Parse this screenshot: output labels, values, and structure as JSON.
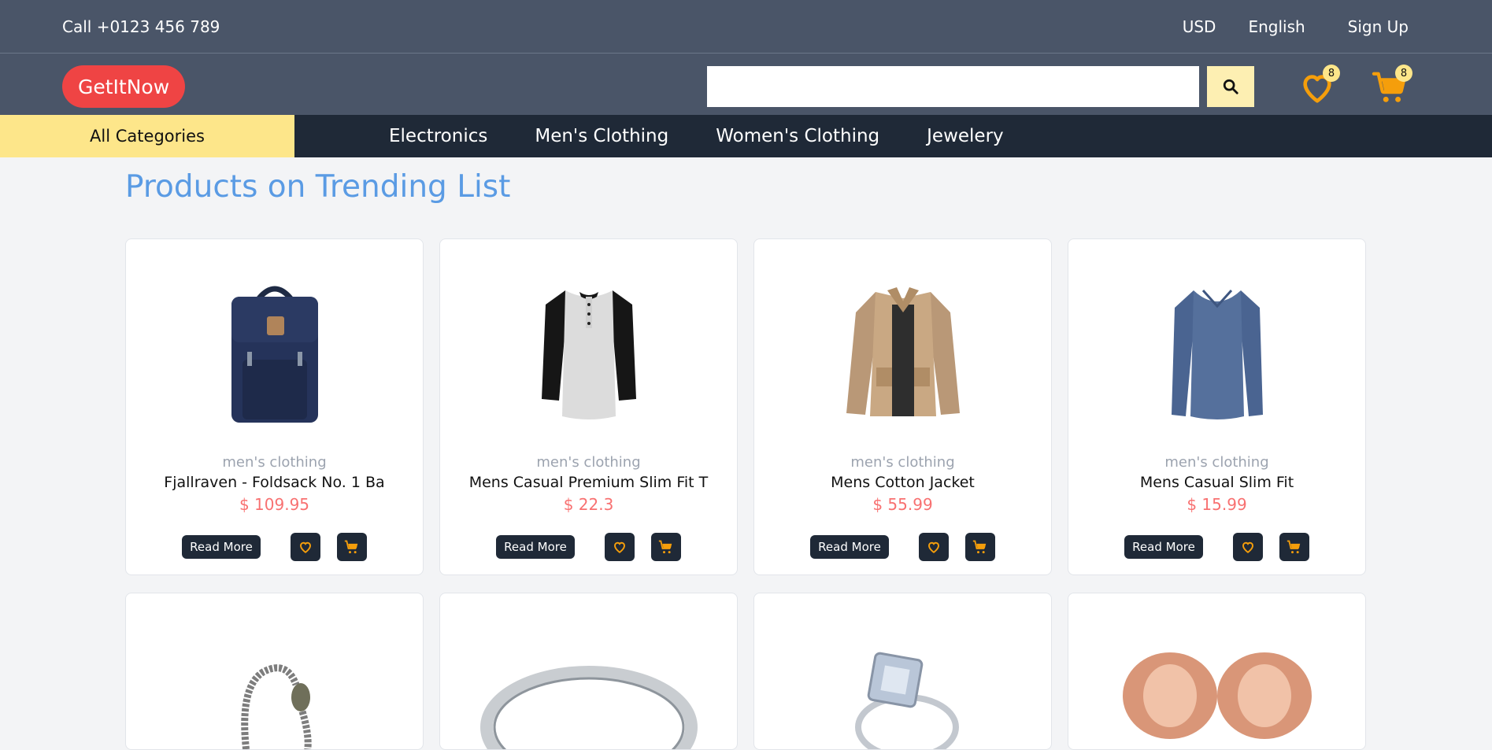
{
  "topbar": {
    "phone": "Call +0123 456 789",
    "currency": "USD",
    "language": "English",
    "signup": "Sign Up"
  },
  "header": {
    "logo": "GetItNow",
    "search_placeholder": "",
    "wishlist_count": "8",
    "cart_count": "8"
  },
  "nav": {
    "all_categories": "All Categories",
    "items": [
      "Electronics",
      "Men's Clothing",
      "Women's Clothing",
      "Jewelery"
    ]
  },
  "section_title": "Products on Trending List",
  "products": [
    {
      "category": "men's clothing",
      "name": "Fjallraven - Foldsack No. 1 Ba",
      "price": "$ 109.95",
      "image": "backpack-image"
    },
    {
      "category": "men's clothing",
      "name": "Mens Casual Premium Slim Fit T",
      "price": "$ 22.3",
      "image": "tshirt-image"
    },
    {
      "category": "men's clothing",
      "name": "Mens Cotton Jacket",
      "price": "$ 55.99",
      "image": "jacket-image"
    },
    {
      "category": "men's clothing",
      "name": "Mens Casual Slim Fit",
      "price": "$ 15.99",
      "image": "sweater-image"
    }
  ],
  "buttons": {
    "read_more": "Read More"
  },
  "colors": {
    "topbar_bg": "#4a5568",
    "nav_bg": "#1f2937",
    "logo_red": "#ef4444",
    "accent_yellow": "#fde68a",
    "title_blue": "#5a9be4",
    "price_red": "#f87171",
    "icon_orange": "#f59e0b"
  }
}
